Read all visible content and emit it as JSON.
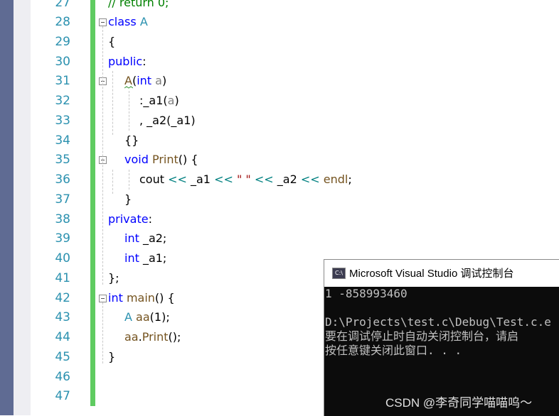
{
  "editor": {
    "line_numbers": [
      "27",
      "28",
      "29",
      "30",
      "31",
      "32",
      "33",
      "34",
      "35",
      "36",
      "37",
      "38",
      "39",
      "40",
      "41",
      "42",
      "43",
      "44",
      "45",
      "46",
      "47"
    ],
    "lines": {
      "l27": {
        "comment": "// return 0;"
      },
      "l28": {
        "kw": "class",
        "name": "A"
      },
      "l29": {
        "text": "{"
      },
      "l30": {
        "kw": "public",
        "colon": ":"
      },
      "l31": {
        "fn": "A",
        "open": "(",
        "kw": "int",
        "param": "a",
        "close": ")"
      },
      "l32": {
        "pre": ":_a1(",
        "param": "a",
        "post": ")"
      },
      "l33": {
        "text": ", _a2(_a1)"
      },
      "l34": {
        "text": "{}"
      },
      "l35": {
        "kw": "void",
        "fn": "Print",
        "rest": "() {"
      },
      "l36": {
        "a": "cout ",
        "op1": "<<",
        "b": " _a1 ",
        "op2": "<<",
        "str": " \" \" ",
        "op3": "<<",
        "c": " _a2 ",
        "op4": "<<",
        "endl": " endl",
        "end": ";"
      },
      "l37": {
        "text": "}"
      },
      "l38": {
        "kw": "private",
        "colon": ":"
      },
      "l39": {
        "kw": "int",
        "rest": " _a2;"
      },
      "l40": {
        "kw": "int",
        "rest": " _a1;"
      },
      "l41": {
        "text": "};"
      },
      "l42": {
        "kw": "int",
        "fn": " main",
        "rest": "() {"
      },
      "l43": {
        "cls": "A",
        "var": " aa",
        "rest": "(1);"
      },
      "l44": {
        "var": "aa",
        "dot": ".",
        "fn": "Print",
        "rest": "();"
      },
      "l45": {
        "text": "}"
      }
    }
  },
  "console": {
    "icon_text": "C:\\",
    "title": "Microsoft Visual Studio 调试控制台",
    "lines": [
      "1 -858993460",
      "",
      "D:\\Projects\\test.c\\Debug\\Test.c.e",
      "要在调试停止时自动关闭控制台，请启",
      "按任意键关闭此窗口. . ."
    ],
    "watermark": "CSDN @李奇同学喵喵呜～"
  },
  "colors": {
    "keyword": "#0000ff",
    "class": "#2b91af",
    "function": "#74531f",
    "parameter": "#808080",
    "string": "#a31515",
    "operator": "#008080",
    "comment": "#008000",
    "line_number": "#2b91af",
    "change_bar": "#5fcb61",
    "console_bg": "#0c0c0c",
    "console_text": "#c0c0c0"
  }
}
